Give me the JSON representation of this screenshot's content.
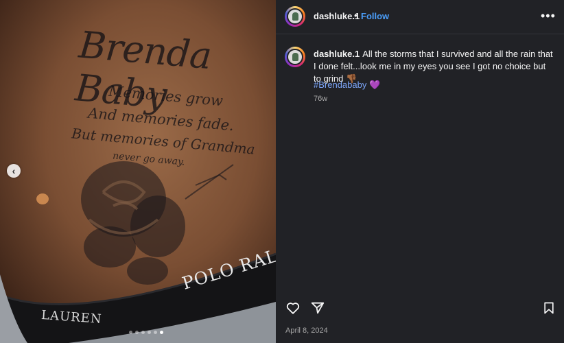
{
  "post": {
    "username": "dashluke.1",
    "separator": "•",
    "follow_label": "Follow",
    "more_icon": "more-options-icon",
    "caption_text": "All the storms that I survived and all the rain that I done felt...look me in my eyes you see I got no choice but to grind 👎🏾",
    "hashtag": "#Brendababy 💜",
    "time_ago": "76w",
    "date": "April 8, 2024"
  },
  "media": {
    "tattoo_line1": "Brenda Baby",
    "tattoo_line2": "Memories grow",
    "tattoo_line3": "And memories fade.",
    "tattoo_line4": "But memories of Grandma",
    "tattoo_line5": "never go away.",
    "waistband_text": "POLO RALPH",
    "waistband_text2": "LAUREN",
    "carousel_count": 6,
    "carousel_active": 6
  },
  "actions": {
    "like_icon": "heart-icon",
    "share_icon": "send-icon",
    "save_icon": "bookmark-icon"
  },
  "colors": {
    "panel_bg": "#212226",
    "link_blue": "#4a9cf6",
    "hashtag_blue": "#7ca5f8"
  }
}
